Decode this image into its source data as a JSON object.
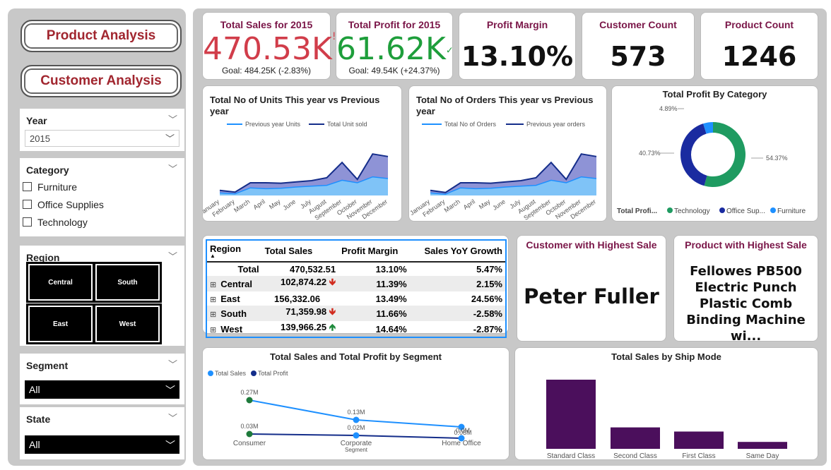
{
  "nav": {
    "product_analysis": "Product Analysis",
    "customer_analysis": "Customer Analysis"
  },
  "filters": {
    "year": {
      "title": "Year",
      "selected": "2015"
    },
    "category": {
      "title": "Category",
      "options": [
        "Furniture",
        "Office Supplies",
        "Technology"
      ]
    },
    "region": {
      "title": "Region",
      "tiles": [
        "Central",
        "South",
        "East",
        "West"
      ]
    },
    "segment": {
      "title": "Segment",
      "selected": "All"
    },
    "state": {
      "title": "State",
      "selected": "All"
    }
  },
  "kpis": {
    "sales": {
      "title": "Total Sales for 2015",
      "value": "470.53K",
      "goal": "Goal: 484.25K (-2.83%)",
      "indicator": "!"
    },
    "profit": {
      "title": "Total Profit for 2015",
      "value": "61.62K",
      "goal": "Goal: 49.54K (+24.37%)",
      "indicator": "✓"
    },
    "margin": {
      "title": "Profit Margin",
      "value": "13.10%"
    },
    "customers": {
      "title": "Customer Count",
      "value": "573"
    },
    "products": {
      "title": "Product Count",
      "value": "1246"
    }
  },
  "units_chart": {
    "title": "Total No of Units This year vs Previous year",
    "legend": [
      "Previous year Units",
      "Total Unit sold"
    ],
    "months": [
      "January",
      "February",
      "March",
      "April",
      "May",
      "June",
      "July",
      "August",
      "September",
      "October",
      "November",
      "December"
    ]
  },
  "orders_chart": {
    "title": "Total No of Orders This year vs Previous year",
    "legend": [
      "Total No of Orders",
      "Previous year orders"
    ],
    "months": [
      "January",
      "February",
      "March",
      "April",
      "May",
      "June",
      "July",
      "August",
      "September",
      "October",
      "November",
      "December"
    ]
  },
  "donut": {
    "title": "Total Profit By Category",
    "labels": {
      "technology": "54.37%",
      "office": "40.73%",
      "furniture": "4.89%"
    },
    "legend_title": "Total Profi...",
    "legend": [
      "Technology",
      "Office Sup...",
      "Furniture"
    ]
  },
  "region_table": {
    "headers": [
      "Region",
      "Total Sales",
      "Profit Margin",
      "Sales YoY Growth"
    ],
    "rows": [
      {
        "region": "Total",
        "sales": "470,532.51",
        "margin": "13.10%",
        "growth": "5.47%"
      },
      {
        "region": "Central",
        "sales": "102,874.22",
        "margin": "11.39%",
        "growth": "2.15%"
      },
      {
        "region": "East",
        "sales": "156,332.06",
        "margin": "13.49%",
        "growth": "24.56%"
      },
      {
        "region": "South",
        "sales": "71,359.98",
        "margin": "11.66%",
        "growth": "-2.58%"
      },
      {
        "region": "West",
        "sales": "139,966.25",
        "margin": "14.64%",
        "growth": "-2.87%"
      }
    ],
    "expand": "⊞"
  },
  "top_customer": {
    "title": "Customer with Highest Sale",
    "value": "Peter Fuller"
  },
  "top_product": {
    "title": "Product with Highest Sale",
    "line1": "Fellowes PB500",
    "line2": "Electric Punch",
    "line3": "Plastic Comb",
    "line4": "Binding Machine wi..."
  },
  "segment_chart": {
    "title": "Total Sales and Total Profit by Segment",
    "legend": [
      "Total Sales",
      "Total Profit"
    ],
    "xlabel": "Segment",
    "categories": [
      "Consumer",
      "Corporate",
      "Home Office"
    ],
    "sales_labels": [
      "0.27M",
      "0.13M",
      "0.08M"
    ],
    "profit_labels": [
      "0.03M",
      "0.02M",
      "0.0M"
    ]
  },
  "ship_chart": {
    "title": "Total Sales by Ship Mode",
    "categories": [
      "Standard Class",
      "Second Class",
      "First Class",
      "Same Day"
    ]
  },
  "colors": {
    "accent": "#a1262f",
    "kpi_title": "#7a1648",
    "sales_red": "#d13d4a",
    "profit_green": "#1e9e3b",
    "bars": "#4b0f5c",
    "line_light": "#1e90ff",
    "line_dark": "#142d8a"
  },
  "chart_data": [
    {
      "type": "area",
      "title": "Total No of Units This year vs Previous year",
      "categories": [
        "January",
        "February",
        "March",
        "April",
        "May",
        "June",
        "July",
        "August",
        "September",
        "October",
        "November",
        "December"
      ],
      "series": [
        {
          "name": "Total Unit sold",
          "values": [
            12,
            8,
            30,
            30,
            29,
            32,
            35,
            42,
            78,
            38,
            98,
            92
          ]
        },
        {
          "name": "Previous year Units",
          "values": [
            6,
            4,
            18,
            16,
            17,
            20,
            22,
            24,
            36,
            30,
            44,
            40
          ]
        }
      ]
    },
    {
      "type": "area",
      "title": "Total No of Orders This year vs Previous year",
      "categories": [
        "January",
        "February",
        "March",
        "April",
        "May",
        "June",
        "July",
        "August",
        "September",
        "October",
        "November",
        "December"
      ],
      "series": [
        {
          "name": "Total No of Orders",
          "values": [
            12,
            7,
            30,
            30,
            29,
            32,
            35,
            42,
            78,
            38,
            98,
            92
          ]
        },
        {
          "name": "Previous year orders",
          "values": [
            6,
            3,
            18,
            16,
            17,
            20,
            22,
            24,
            36,
            30,
            44,
            40
          ]
        }
      ]
    },
    {
      "type": "pie",
      "title": "Total Profit By Category",
      "categories": [
        "Technology",
        "Office Sup...",
        "Furniture"
      ],
      "values": [
        54.37,
        40.73,
        4.89
      ]
    },
    {
      "type": "line",
      "title": "Total Sales and Total Profit by Segment",
      "categories": [
        "Consumer",
        "Corporate",
        "Home Office"
      ],
      "series": [
        {
          "name": "Total Sales",
          "values": [
            0.27,
            0.13,
            0.08
          ]
        },
        {
          "name": "Total Profit",
          "values": [
            0.03,
            0.02,
            0.0
          ]
        }
      ]
    },
    {
      "type": "bar",
      "title": "Total Sales by Ship Mode",
      "categories": [
        "Standard Class",
        "Second Class",
        "First Class",
        "Same Day"
      ],
      "values": [
        100,
        31,
        25,
        10
      ]
    }
  ]
}
